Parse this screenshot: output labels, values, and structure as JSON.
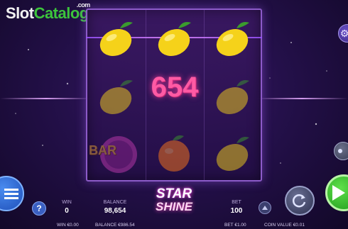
{
  "watermark": {
    "brand_left": "Slot",
    "brand_right": "Catalog",
    "suffix": ".com"
  },
  "reels": {
    "grid": [
      [
        "lemon",
        "lemon",
        "lemon"
      ],
      [
        "lemon",
        "empty",
        "lemon"
      ],
      [
        "bar",
        "orange",
        "lemon"
      ]
    ],
    "bar_symbol_text": "BAR",
    "win_amount": "654"
  },
  "game_logo": {
    "line1": "STAR",
    "line2": "SHINE"
  },
  "hud": {
    "win_label": "WIN",
    "win_value": "0",
    "balance_label": "BALANCE",
    "balance_value": "98,654",
    "bet_label": "BET",
    "bet_value": "100"
  },
  "footer": {
    "win": "WIN €0.00",
    "balance": "BALANCE €986.54",
    "bet": "BET €1.00",
    "coin_value": "COIN VALUE €0.01"
  },
  "colors": {
    "accent": "#3cc43c",
    "win_amount": "#ff5aa4",
    "frame": "#8c5bc8"
  }
}
